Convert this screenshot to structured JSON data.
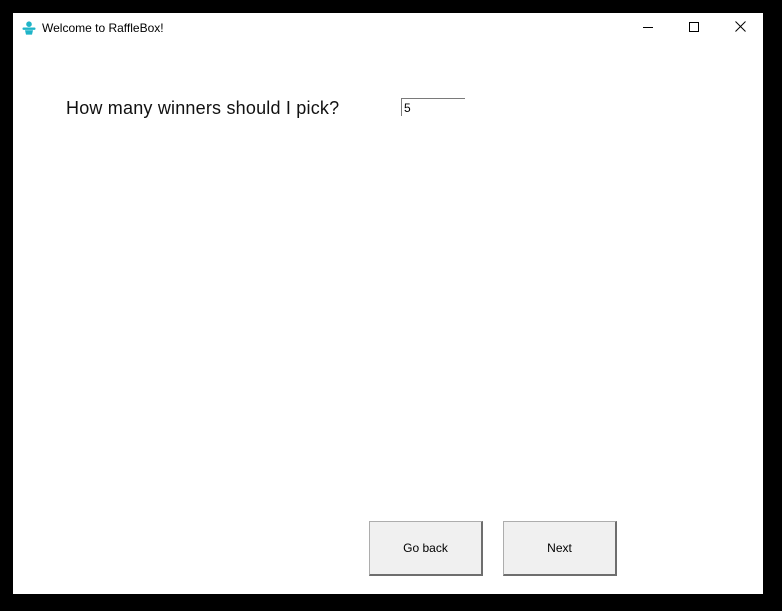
{
  "window": {
    "title": "Welcome to RaffleBox!",
    "app_icon": "raffle-person-icon",
    "controls": {
      "minimize_icon": "minimize-icon",
      "maximize_icon": "maximize-icon",
      "close_icon": "close-icon"
    }
  },
  "form": {
    "question": "How many winners should I pick?",
    "winners_value": "5"
  },
  "buttons": {
    "back_label": "Go back",
    "next_label": "Next"
  },
  "colors": {
    "frame": "#000000",
    "background": "#ffffff",
    "button_face": "#f0f0f0",
    "icon_accent": "#1fb4c8"
  }
}
